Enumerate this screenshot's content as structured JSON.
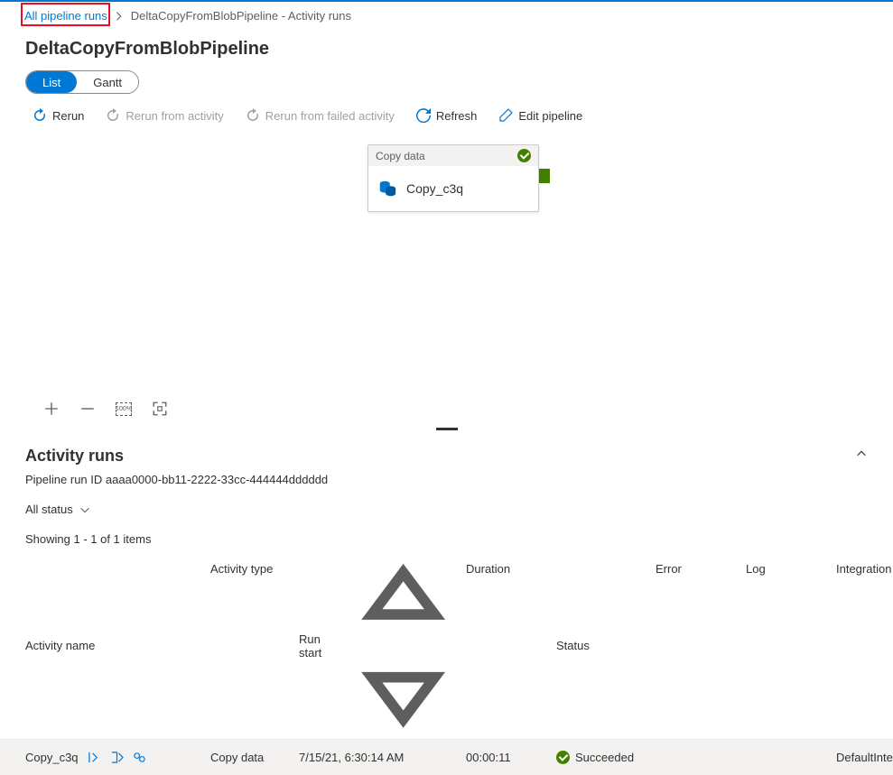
{
  "breadcrumb": {
    "link": "All pipeline runs",
    "current": "DeltaCopyFromBlobPipeline - Activity runs"
  },
  "pageTitle": "DeltaCopyFromBlobPipeline",
  "viewToggle": {
    "list": "List",
    "gantt": "Gantt"
  },
  "toolbar": {
    "rerun": "Rerun",
    "rerunActivity": "Rerun from activity",
    "rerunFailed": "Rerun from failed activity",
    "refresh": "Refresh",
    "editPipeline": "Edit pipeline"
  },
  "activityCard": {
    "header": "Copy data",
    "name": "Copy_c3q"
  },
  "zoom": {
    "percent": "100%"
  },
  "section": {
    "title": "Activity runs",
    "runIdLabel": "Pipeline run ID",
    "runId": "aaaa0000-bb11-2222-33cc-444444dddddd"
  },
  "filter": {
    "allStatus": "All status"
  },
  "showing": "Showing 1 - 1 of 1 items",
  "columns": {
    "name": "Activity name",
    "type": "Activity type",
    "start": "Run start",
    "duration": "Duration",
    "status": "Status",
    "error": "Error",
    "log": "Log",
    "integration": "Integration r"
  },
  "rows": [
    {
      "name": "Copy_c3q",
      "type": "Copy data",
      "start": "7/15/21, 6:30:14 AM",
      "duration": "00:00:11",
      "status": "Succeeded",
      "integration": "DefaultIntegr"
    }
  ]
}
